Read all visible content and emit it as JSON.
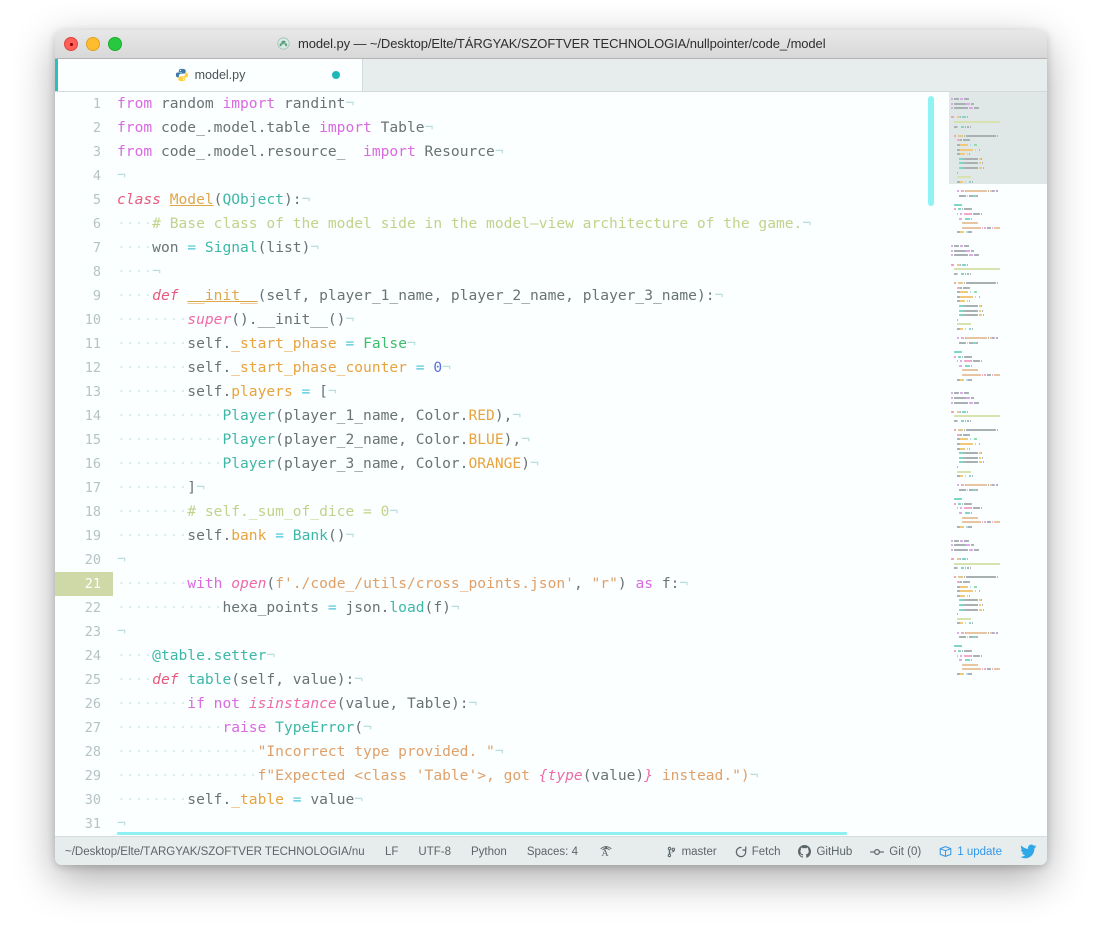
{
  "window": {
    "title": "model.py — ~/Desktop/Elte/TÁRGYAK/SZOFTVER TECHNOLOGIA/nullpointer/code_/model",
    "title_icon": "python-file-icon",
    "traffic_lights": [
      "close-button",
      "minimize-button",
      "zoom-button"
    ]
  },
  "tabbar": {
    "tabs": [
      {
        "label": "model.py",
        "icon": "python-icon",
        "modified": true,
        "active": true
      }
    ]
  },
  "editor": {
    "active_line": 21,
    "language": "Python",
    "lines": [
      {
        "n": "1",
        "tokens": [
          {
            "t": "from",
            "c": "k-kw"
          },
          {
            "t": " random ",
            "c": "k-var"
          },
          {
            "t": "import",
            "c": "k-kw"
          },
          {
            "t": " randint",
            "c": "k-var"
          },
          {
            "t": "¬",
            "c": "k-eol"
          }
        ]
      },
      {
        "n": "2",
        "tokens": [
          {
            "t": "from",
            "c": "k-kw"
          },
          {
            "t": " code_.model.table ",
            "c": "k-var"
          },
          {
            "t": "import",
            "c": "k-kw"
          },
          {
            "t": " Table",
            "c": "k-var"
          },
          {
            "t": "¬",
            "c": "k-eol"
          }
        ]
      },
      {
        "n": "3",
        "tokens": [
          {
            "t": "from",
            "c": "k-kw"
          },
          {
            "t": " code_.model.resource_ ",
            "c": "k-var"
          },
          {
            "t": " import",
            "c": "k-kw"
          },
          {
            "t": " Resource",
            "c": "k-var"
          },
          {
            "t": "¬",
            "c": "k-eol"
          }
        ]
      },
      {
        "n": "4",
        "tokens": [
          {
            "t": "¬",
            "c": "k-eol"
          }
        ]
      },
      {
        "n": "5",
        "tokens": [
          {
            "t": "class",
            "c": "k-def"
          },
          {
            "t": " ",
            "c": "k-var"
          },
          {
            "t": "Model",
            "c": "k-fnu"
          },
          {
            "t": "(",
            "c": "k-punc"
          },
          {
            "t": "QObject",
            "c": "k-fn"
          },
          {
            "t": "):",
            "c": "k-punc"
          },
          {
            "t": "¬",
            "c": "k-eol"
          }
        ]
      },
      {
        "n": "6",
        "tokens": [
          {
            "t": "····",
            "c": "k-ws"
          },
          {
            "t": "# Base class of the model side in the model—view architecture of the game.",
            "c": "k-comment"
          },
          {
            "t": "¬",
            "c": "k-eol"
          }
        ]
      },
      {
        "n": "7",
        "tokens": [
          {
            "t": "····",
            "c": "k-ws"
          },
          {
            "t": "won ",
            "c": "k-var"
          },
          {
            "t": "=",
            "c": "k-op"
          },
          {
            "t": " ",
            "c": "k-var"
          },
          {
            "t": "Signal",
            "c": "k-fn"
          },
          {
            "t": "(",
            "c": "k-punc"
          },
          {
            "t": "list",
            "c": "k-var"
          },
          {
            "t": ")",
            "c": "k-punc"
          },
          {
            "t": "¬",
            "c": "k-eol"
          }
        ]
      },
      {
        "n": "8",
        "tokens": [
          {
            "t": "····",
            "c": "k-ws"
          },
          {
            "t": "¬",
            "c": "k-eol"
          }
        ]
      },
      {
        "n": "9",
        "tokens": [
          {
            "t": "····",
            "c": "k-ws"
          },
          {
            "t": "def",
            "c": "k-def"
          },
          {
            "t": " ",
            "c": "k-var"
          },
          {
            "t": "__init__",
            "c": "k-fnu"
          },
          {
            "t": "(",
            "c": "k-punc"
          },
          {
            "t": "self, player_1_name, player_2_name, player_3_name",
            "c": "k-var"
          },
          {
            "t": "):",
            "c": "k-punc"
          },
          {
            "t": "¬",
            "c": "k-eol"
          }
        ]
      },
      {
        "n": "10",
        "tokens": [
          {
            "t": "········",
            "c": "k-ws"
          },
          {
            "t": "super",
            "c": "k-builtin"
          },
          {
            "t": "().",
            "c": "k-punc"
          },
          {
            "t": "__init__",
            "c": "k-var"
          },
          {
            "t": "()",
            "c": "k-punc"
          },
          {
            "t": "¬",
            "c": "k-eol"
          }
        ]
      },
      {
        "n": "11",
        "tokens": [
          {
            "t": "········",
            "c": "k-ws"
          },
          {
            "t": "self.",
            "c": "k-var"
          },
          {
            "t": "_start_phase",
            "c": "k-attr"
          },
          {
            "t": " ",
            "c": "k-var"
          },
          {
            "t": "=",
            "c": "k-op"
          },
          {
            "t": " ",
            "c": "k-var"
          },
          {
            "t": "False",
            "c": "k-const"
          },
          {
            "t": "¬",
            "c": "k-eol"
          }
        ]
      },
      {
        "n": "12",
        "tokens": [
          {
            "t": "········",
            "c": "k-ws"
          },
          {
            "t": "self.",
            "c": "k-var"
          },
          {
            "t": "_start_phase_counter",
            "c": "k-attr"
          },
          {
            "t": " ",
            "c": "k-var"
          },
          {
            "t": "=",
            "c": "k-op"
          },
          {
            "t": " ",
            "c": "k-var"
          },
          {
            "t": "0",
            "c": "k-num"
          },
          {
            "t": "¬",
            "c": "k-eol"
          }
        ]
      },
      {
        "n": "13",
        "tokens": [
          {
            "t": "········",
            "c": "k-ws"
          },
          {
            "t": "self.",
            "c": "k-var"
          },
          {
            "t": "players",
            "c": "k-attr"
          },
          {
            "t": " ",
            "c": "k-var"
          },
          {
            "t": "=",
            "c": "k-op"
          },
          {
            "t": " [",
            "c": "k-punc"
          },
          {
            "t": "¬",
            "c": "k-eol"
          }
        ]
      },
      {
        "n": "14",
        "tokens": [
          {
            "t": "············",
            "c": "k-ws"
          },
          {
            "t": "Player",
            "c": "k-fn"
          },
          {
            "t": "(",
            "c": "k-punc"
          },
          {
            "t": "player_1_name, Color.",
            "c": "k-var"
          },
          {
            "t": "RED",
            "c": "k-attr"
          },
          {
            "t": "),",
            "c": "k-punc"
          },
          {
            "t": "¬",
            "c": "k-eol"
          }
        ]
      },
      {
        "n": "15",
        "tokens": [
          {
            "t": "············",
            "c": "k-ws"
          },
          {
            "t": "Player",
            "c": "k-fn"
          },
          {
            "t": "(",
            "c": "k-punc"
          },
          {
            "t": "player_2_name, Color.",
            "c": "k-var"
          },
          {
            "t": "BLUE",
            "c": "k-attr"
          },
          {
            "t": "),",
            "c": "k-punc"
          },
          {
            "t": "¬",
            "c": "k-eol"
          }
        ]
      },
      {
        "n": "16",
        "tokens": [
          {
            "t": "············",
            "c": "k-ws"
          },
          {
            "t": "Player",
            "c": "k-fn"
          },
          {
            "t": "(",
            "c": "k-punc"
          },
          {
            "t": "player_3_name, Color.",
            "c": "k-var"
          },
          {
            "t": "ORANGE",
            "c": "k-attr"
          },
          {
            "t": ")",
            "c": "k-punc"
          },
          {
            "t": "¬",
            "c": "k-eol"
          }
        ]
      },
      {
        "n": "17",
        "tokens": [
          {
            "t": "········",
            "c": "k-ws"
          },
          {
            "t": "]",
            "c": "k-punc"
          },
          {
            "t": "¬",
            "c": "k-eol"
          }
        ]
      },
      {
        "n": "18",
        "tokens": [
          {
            "t": "········",
            "c": "k-ws"
          },
          {
            "t": "# self._sum_of_dice = 0",
            "c": "k-comment"
          },
          {
            "t": "¬",
            "c": "k-eol"
          }
        ]
      },
      {
        "n": "19",
        "tokens": [
          {
            "t": "········",
            "c": "k-ws"
          },
          {
            "t": "self.",
            "c": "k-var"
          },
          {
            "t": "bank",
            "c": "k-attr"
          },
          {
            "t": " ",
            "c": "k-var"
          },
          {
            "t": "=",
            "c": "k-op"
          },
          {
            "t": " ",
            "c": "k-var"
          },
          {
            "t": "Bank",
            "c": "k-fn"
          },
          {
            "t": "()",
            "c": "k-punc"
          },
          {
            "t": "¬",
            "c": "k-eol"
          }
        ]
      },
      {
        "n": "20",
        "tokens": [
          {
            "t": "¬",
            "c": "k-eol"
          }
        ]
      },
      {
        "n": "21",
        "active": true,
        "tokens": [
          {
            "t": "········",
            "c": "k-ws"
          },
          {
            "t": "with",
            "c": "k-kw"
          },
          {
            "t": " ",
            "c": "k-var"
          },
          {
            "t": "open",
            "c": "k-builtin"
          },
          {
            "t": "(",
            "c": "k-punc"
          },
          {
            "t": "f'./code_/utils/cross_points.json'",
            "c": "k-str"
          },
          {
            "t": ", ",
            "c": "k-punc"
          },
          {
            "t": "\"r\"",
            "c": "k-str"
          },
          {
            "t": ") ",
            "c": "k-punc"
          },
          {
            "t": "as",
            "c": "k-kw"
          },
          {
            "t": " f:",
            "c": "k-var"
          },
          {
            "t": "¬",
            "c": "k-eol"
          }
        ]
      },
      {
        "n": "22",
        "tokens": [
          {
            "t": "············",
            "c": "k-ws"
          },
          {
            "t": "hexa_points ",
            "c": "k-var"
          },
          {
            "t": "=",
            "c": "k-op"
          },
          {
            "t": " json.",
            "c": "k-var"
          },
          {
            "t": "load",
            "c": "k-fn"
          },
          {
            "t": "(f)",
            "c": "k-punc"
          },
          {
            "t": "¬",
            "c": "k-eol"
          }
        ]
      },
      {
        "n": "23",
        "tokens": [
          {
            "t": "¬",
            "c": "k-eol"
          }
        ]
      },
      {
        "n": "24",
        "tokens": [
          {
            "t": "····",
            "c": "k-ws"
          },
          {
            "t": "@table.setter",
            "c": "k-deco"
          },
          {
            "t": "¬",
            "c": "k-eol"
          }
        ]
      },
      {
        "n": "25",
        "tokens": [
          {
            "t": "····",
            "c": "k-ws"
          },
          {
            "t": "def",
            "c": "k-def"
          },
          {
            "t": " ",
            "c": "k-var"
          },
          {
            "t": "table",
            "c": "k-fn"
          },
          {
            "t": "(",
            "c": "k-punc"
          },
          {
            "t": "self, value",
            "c": "k-var"
          },
          {
            "t": "):",
            "c": "k-punc"
          },
          {
            "t": "¬",
            "c": "k-eol"
          }
        ]
      },
      {
        "n": "26",
        "tokens": [
          {
            "t": "········",
            "c": "k-ws"
          },
          {
            "t": "if",
            "c": "k-kw"
          },
          {
            "t": " ",
            "c": "k-var"
          },
          {
            "t": "not",
            "c": "k-kw"
          },
          {
            "t": " ",
            "c": "k-var"
          },
          {
            "t": "isinstance",
            "c": "k-builtin"
          },
          {
            "t": "(",
            "c": "k-punc"
          },
          {
            "t": "value, Table",
            "c": "k-var"
          },
          {
            "t": "):",
            "c": "k-punc"
          },
          {
            "t": "¬",
            "c": "k-eol"
          }
        ]
      },
      {
        "n": "27",
        "tokens": [
          {
            "t": "············",
            "c": "k-ws"
          },
          {
            "t": "raise",
            "c": "k-raise"
          },
          {
            "t": " ",
            "c": "k-var"
          },
          {
            "t": "TypeError",
            "c": "k-fn"
          },
          {
            "t": "(",
            "c": "k-punc"
          },
          {
            "t": "¬",
            "c": "k-eol"
          }
        ]
      },
      {
        "n": "28",
        "tokens": [
          {
            "t": "················",
            "c": "k-ws"
          },
          {
            "t": "\"Incorrect type provided. \"",
            "c": "k-str"
          },
          {
            "t": "¬",
            "c": "k-eol"
          }
        ]
      },
      {
        "n": "29",
        "tokens": [
          {
            "t": "················",
            "c": "k-ws"
          },
          {
            "t": "f\"Expected <class 'Table'>, got ",
            "c": "k-str"
          },
          {
            "t": "{",
            "c": "k-builtin"
          },
          {
            "t": "type",
            "c": "k-builtin"
          },
          {
            "t": "(value)",
            "c": "k-var"
          },
          {
            "t": "}",
            "c": "k-builtin"
          },
          {
            "t": " instead.\")",
            "c": "k-str"
          },
          {
            "t": "¬",
            "c": "k-eol"
          }
        ]
      },
      {
        "n": "30",
        "tokens": [
          {
            "t": "········",
            "c": "k-ws"
          },
          {
            "t": "self.",
            "c": "k-var"
          },
          {
            "t": "_table",
            "c": "k-attr"
          },
          {
            "t": " ",
            "c": "k-var"
          },
          {
            "t": "=",
            "c": "k-op"
          },
          {
            "t": " value",
            "c": "k-var"
          },
          {
            "t": "¬",
            "c": "k-eol"
          }
        ]
      },
      {
        "n": "31",
        "tokens": [
          {
            "t": "¬",
            "c": "k-eol"
          }
        ]
      }
    ]
  },
  "statusbar": {
    "path": "~/Desktop/Elte/TÁRGYAK/SZOFTVER TECHNOLOGIA/nullpoi",
    "line_ending": "LF",
    "encoding": "UTF-8",
    "grammar": "Python",
    "indent": "Spaces: 4",
    "whitespace_icon": "invisible-characters-icon",
    "branch": "master",
    "branch_icon": "git-branch-icon",
    "fetch": "Fetch",
    "fetch_icon": "refresh-icon",
    "github": "GitHub",
    "github_icon": "github-icon",
    "git": "Git (0)",
    "git_icon": "git-commit-icon",
    "updates": "1 update",
    "updates_icon": "package-icon",
    "bird_icon": "twitter-bird-icon"
  },
  "colors": {
    "accent_teal": "#2bbfbf",
    "titlebar_bg": "#e0e0e0",
    "editor_bg": "#fbffff",
    "statusbar_bg": "#e7eced",
    "active_line_gutter": "#cfd9a8",
    "scrollbar": "#8df3f3",
    "keyword": "#d96ae0",
    "string": "#dfa06a",
    "comment": "#c3d28a",
    "function": "#3fb7a7",
    "constant": "#e8a33d",
    "number": "#5a6fe0",
    "boolean": "#3ebd6e"
  }
}
